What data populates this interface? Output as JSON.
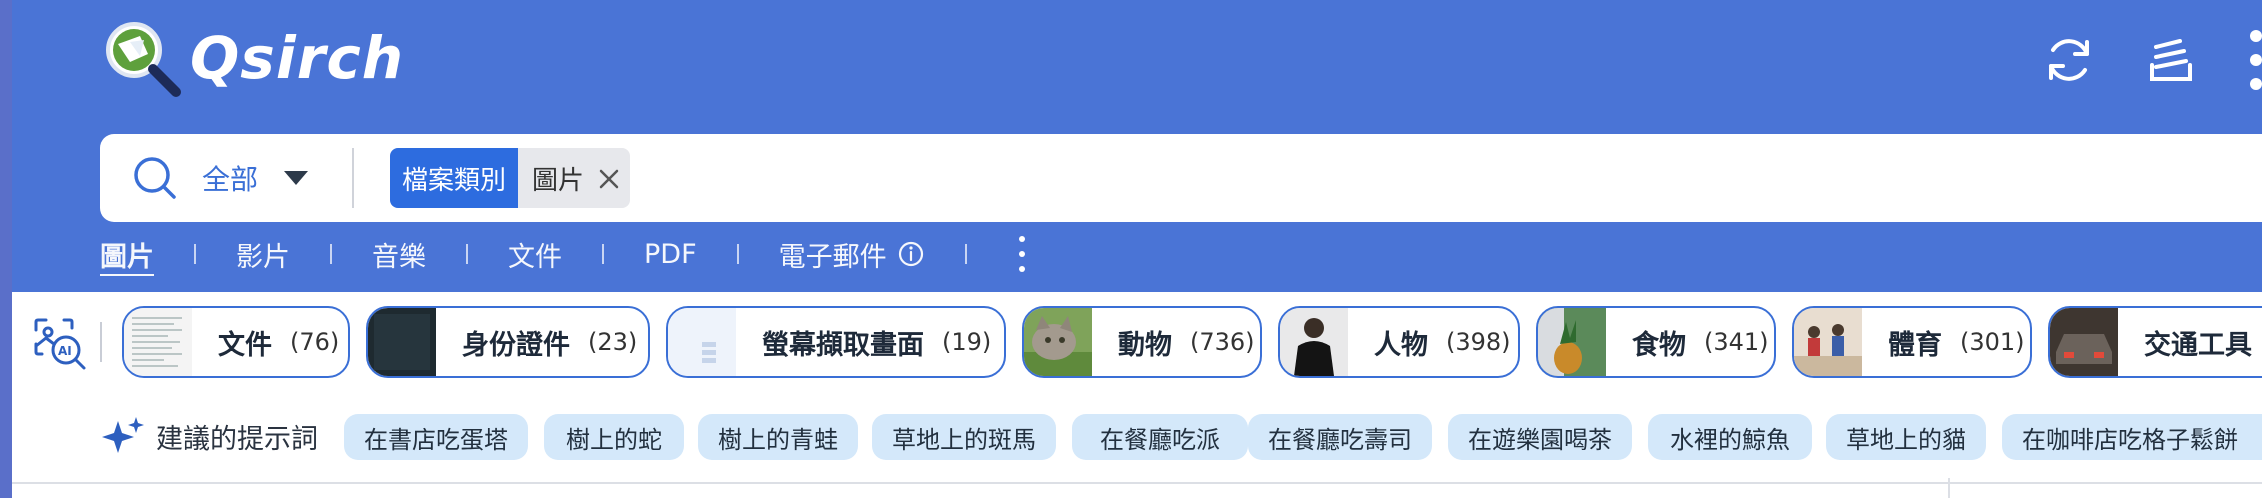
{
  "colors": {
    "brand": "#4a74d6",
    "edge": "#5a6fc9",
    "accent": "#3a6fd6",
    "chip_key": "#2d6cdf",
    "suggestion_bg": "#d4e8fa"
  },
  "app": {
    "title": "Qsirch"
  },
  "header": {
    "actions": [
      {
        "name": "sync-icon"
      },
      {
        "name": "tasks-icon"
      },
      {
        "name": "more-vertical-icon"
      }
    ]
  },
  "search": {
    "scope": "全部",
    "filter": {
      "key": "檔案類別",
      "value": "圖片"
    }
  },
  "tabs": [
    {
      "label": "圖片",
      "active": true
    },
    {
      "label": "影片"
    },
    {
      "label": "音樂"
    },
    {
      "label": "文件"
    },
    {
      "label": "PDF"
    },
    {
      "label": "電子郵件"
    }
  ],
  "categories": [
    {
      "label": "文件",
      "count": "(76)",
      "thumb": "document-thumb"
    },
    {
      "label": "身份證件",
      "count": "(23)",
      "thumb": "id-card-thumb"
    },
    {
      "label": "螢幕擷取畫面",
      "count": "(19)",
      "thumb": "screenshot-thumb"
    },
    {
      "label": "動物",
      "count": "(736)",
      "thumb": "cat-thumb"
    },
    {
      "label": "人物",
      "count": "(398)",
      "thumb": "person-thumb"
    },
    {
      "label": "食物",
      "count": "(341)",
      "thumb": "pineapple-thumb"
    },
    {
      "label": "體育",
      "count": "(301)",
      "thumb": "sports-thumb"
    },
    {
      "label": "交通工具",
      "count": "",
      "thumb": "car-thumb"
    }
  ],
  "suggestions": {
    "label": "建議的提示詞",
    "items": [
      "在書店吃蛋塔",
      "樹上的蛇",
      "樹上的青蛙",
      "草地上的斑馬",
      "在餐廳吃派",
      "在餐廳吃壽司",
      "在遊樂園喝茶",
      "水裡的鯨魚",
      "草地上的貓",
      "在咖啡店吃格子鬆餅"
    ]
  }
}
